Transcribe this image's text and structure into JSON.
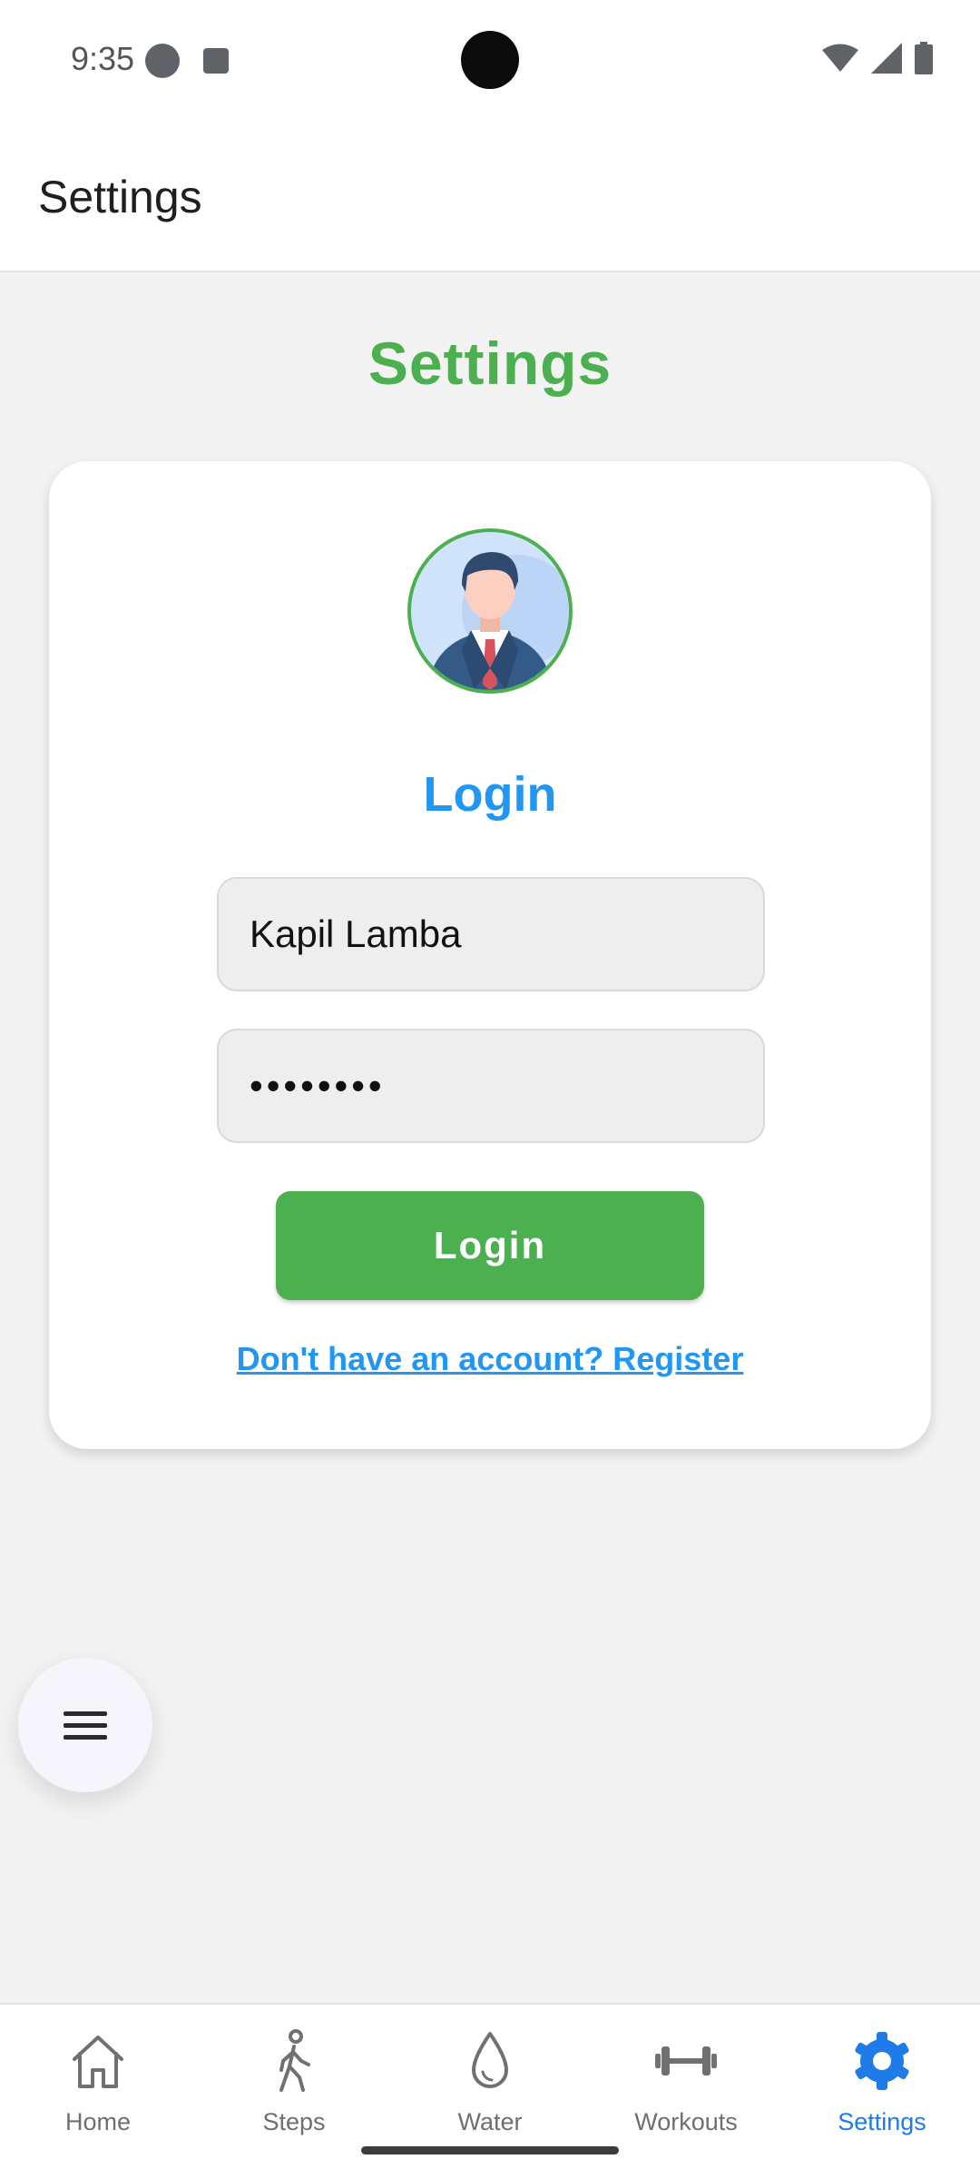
{
  "status_bar": {
    "time": "9:35"
  },
  "app_bar": {
    "title": "Settings"
  },
  "page": {
    "heading": "Settings"
  },
  "login_card": {
    "heading": "Login",
    "username_value": "Kapil Lamba",
    "password_value": "••••••••",
    "login_button_label": "Login",
    "register_link": "Don't have an account? Register"
  },
  "bottom_nav": {
    "items": [
      {
        "label": "Home",
        "icon": "home-icon"
      },
      {
        "label": "Steps",
        "icon": "walking-icon"
      },
      {
        "label": "Water",
        "icon": "water-drop-icon"
      },
      {
        "label": "Workouts",
        "icon": "dumbbell-icon"
      },
      {
        "label": "Settings",
        "icon": "gear-icon"
      }
    ],
    "active_item": "Settings"
  },
  "colors": {
    "accent_green": "#4caf50",
    "accent_blue": "#2196f3",
    "nav_active": "#1e7be8",
    "background": "#f3f3f3"
  }
}
